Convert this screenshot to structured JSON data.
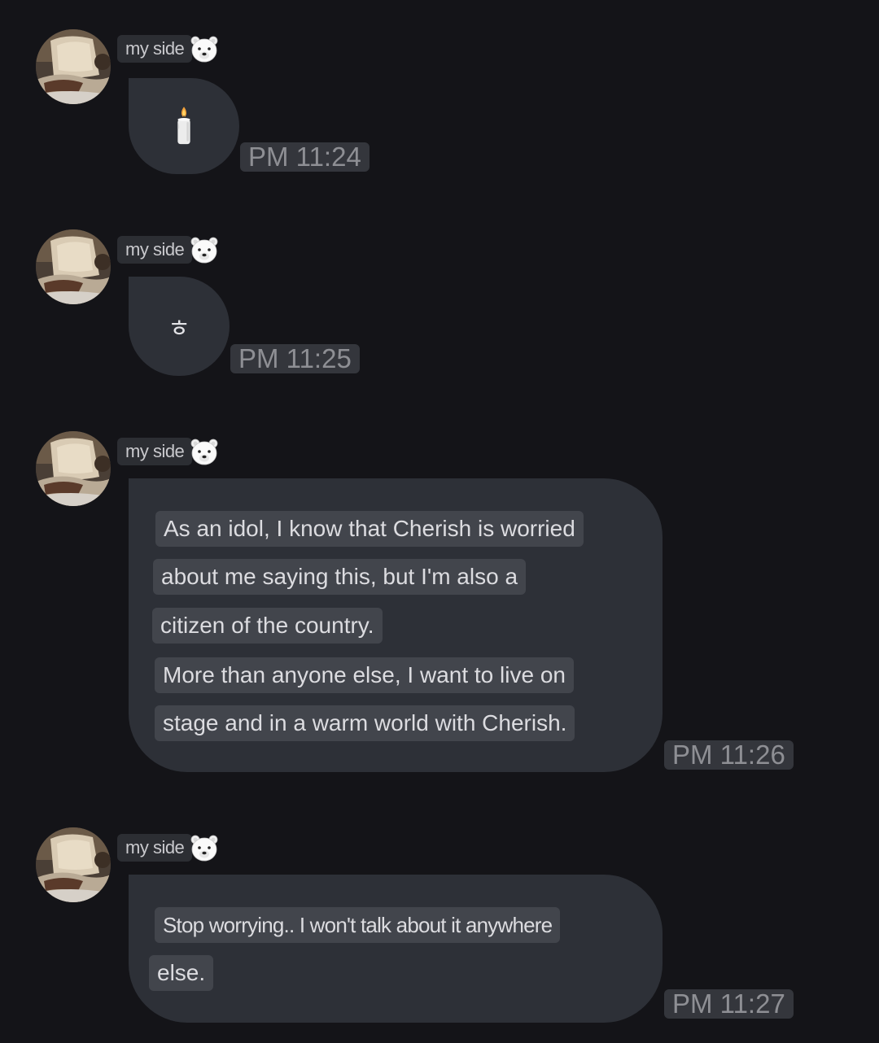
{
  "messages": [
    {
      "sender": "my side",
      "sender_icon": "polar-bear-icon",
      "content_type": "emoji",
      "content_icon": "candle-icon",
      "time": "PM 11:24"
    },
    {
      "sender": "my side",
      "sender_icon": "polar-bear-icon",
      "content_type": "text",
      "text": "ㅎ",
      "time": "PM 11:25"
    },
    {
      "sender": "my side",
      "sender_icon": "polar-bear-icon",
      "content_type": "text",
      "lines": [
        "As an idol, I know that Cherish is worried",
        "about me saying this, but I'm also a",
        "citizen of the country.",
        "More than anyone else, I want to live on",
        "stage and in a warm world with Cherish."
      ],
      "time": "PM 11:26"
    },
    {
      "sender": "my side",
      "sender_icon": "polar-bear-icon",
      "content_type": "text",
      "lines": [
        "Stop worrying.. I won't talk about it anywhere",
        "else."
      ],
      "time": "PM 11:27"
    }
  ],
  "colors": {
    "background": "#141418",
    "bubble": "#2d3037",
    "text_highlight": "#42454c",
    "timestamp": "#8e8f94"
  }
}
